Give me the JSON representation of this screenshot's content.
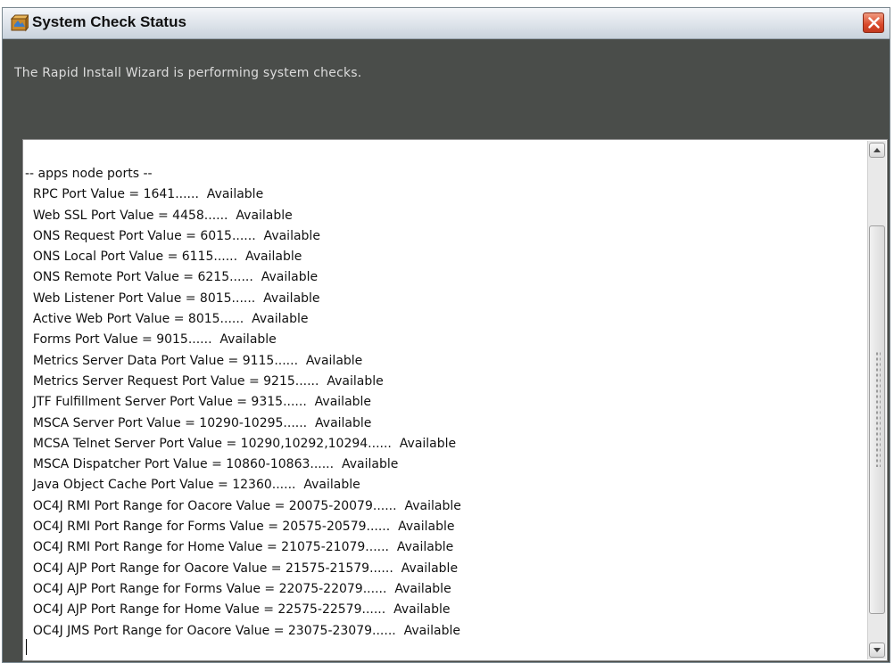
{
  "window": {
    "title": "System Check Status",
    "icon": "installer-app-icon",
    "close": "close-icon"
  },
  "header": {
    "message": "The Rapid Install Wizard is performing system checks."
  },
  "log": {
    "lines": [
      "-- apps node ports --",
      "  RPC Port Value = 1641......  Available",
      "  Web SSL Port Value = 4458......  Available",
      "  ONS Request Port Value = 6015......  Available",
      "  ONS Local Port Value = 6115......  Available",
      "  ONS Remote Port Value = 6215......  Available",
      "  Web Listener Port Value = 8015......  Available",
      "  Active Web Port Value = 8015......  Available",
      "  Forms Port Value = 9015......  Available",
      "  Metrics Server Data Port Value = 9115......  Available",
      "  Metrics Server Request Port Value = 9215......  Available",
      "  JTF Fulfillment Server Port Value = 9315......  Available",
      "  MSCA Server Port Value = 10290-10295......  Available",
      "  MCSA Telnet Server Port Value = 10290,10292,10294......  Available",
      "  MSCA Dispatcher Port Value = 10860-10863......  Available",
      "  Java Object Cache Port Value = 12360......  Available",
      "  OC4J RMI Port Range for Oacore Value = 20075-20079......  Available",
      "  OC4J RMI Port Range for Forms Value = 20575-20579......  Available",
      "  OC4J RMI Port Range for Home Value = 21075-21079......  Available",
      "  OC4J AJP Port Range for Oacore Value = 21575-21579......  Available",
      "  OC4J AJP Port Range for Forms Value = 22075-22079......  Available",
      "  OC4J AJP Port Range for Home Value = 22575-22579......  Available",
      "  OC4J JMS Port Range for Oacore Value = 23075-23079......  Available"
    ]
  },
  "scrollbar": {
    "up_icon": "scroll-up-arrow-icon",
    "down_icon": "scroll-down-arrow-icon"
  }
}
